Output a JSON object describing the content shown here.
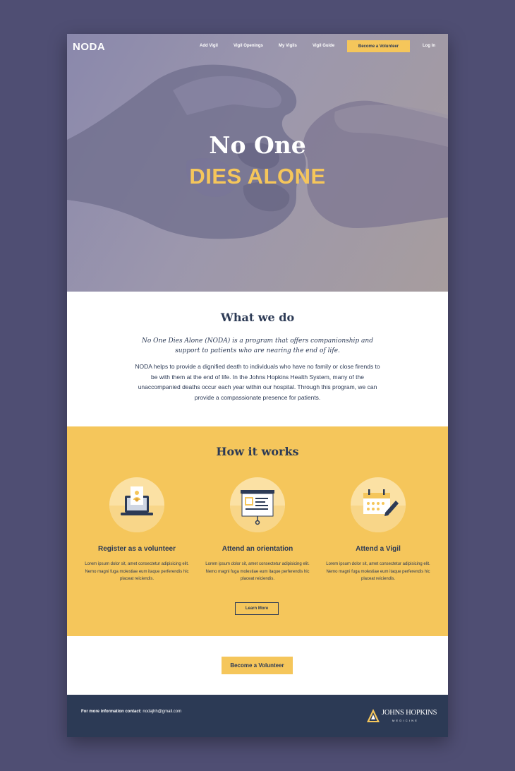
{
  "nav": {
    "logo": "NODA",
    "links": [
      "Add Vigil",
      "Vigil Openings",
      "My Vigils",
      "Vigil Guide"
    ],
    "cta": "Become a Volunteer",
    "login": "Log In"
  },
  "hero": {
    "line1": "No One",
    "line2": "DIES ALONE"
  },
  "what": {
    "title": "What we do",
    "lead": "No One Dies Alone (NODA) is a program that offers companionship and support to patients who are nearing the end of life.",
    "body": "NODA helps to provide a dignified death to individuals who have no family or close firends to be with them at the end of life. In the Johns Hopkins Health System, many of the unaccompanied deaths occur each year within our hospital. Through this program, we can provide a compassionate presence for patients."
  },
  "how": {
    "title": "How it works",
    "steps": [
      {
        "icon": "laptop-register-icon",
        "title": "Register as a volunteer",
        "text": "Lorem ipsum dolor sit, amet consectetur adipisicing elit. Nemo magni fuga molestiae eum itaque perferendis hic placeat reiciendis."
      },
      {
        "icon": "presentation-board-icon",
        "title": "Attend an orientation",
        "text": "Lorem ipsum dolor sit, amet consectetur adipisicing elit. Nemo magni fuga molestiae eum itaque perferendis hic placeat reiciendis."
      },
      {
        "icon": "calendar-pencil-icon",
        "title": "Attend a Vigil",
        "text": "Lorem ipsum dolor sit, amet consectetur adipisicing elit. Nemo magni fuga molestiae eum itaque perferendis hic placeat reiciendis."
      }
    ],
    "learn_more": "Learn More"
  },
  "cta": {
    "label": "Become a Volunteer"
  },
  "footer": {
    "contact_label": "For more information contact:",
    "contact_email": "nodajhh@gmail.com",
    "logo_name": "JOHNS HOPKINS",
    "logo_sub": "MEDICINE"
  },
  "colors": {
    "background": "#4f4e73",
    "accent": "#f5c65b",
    "navy": "#2c3a55"
  }
}
